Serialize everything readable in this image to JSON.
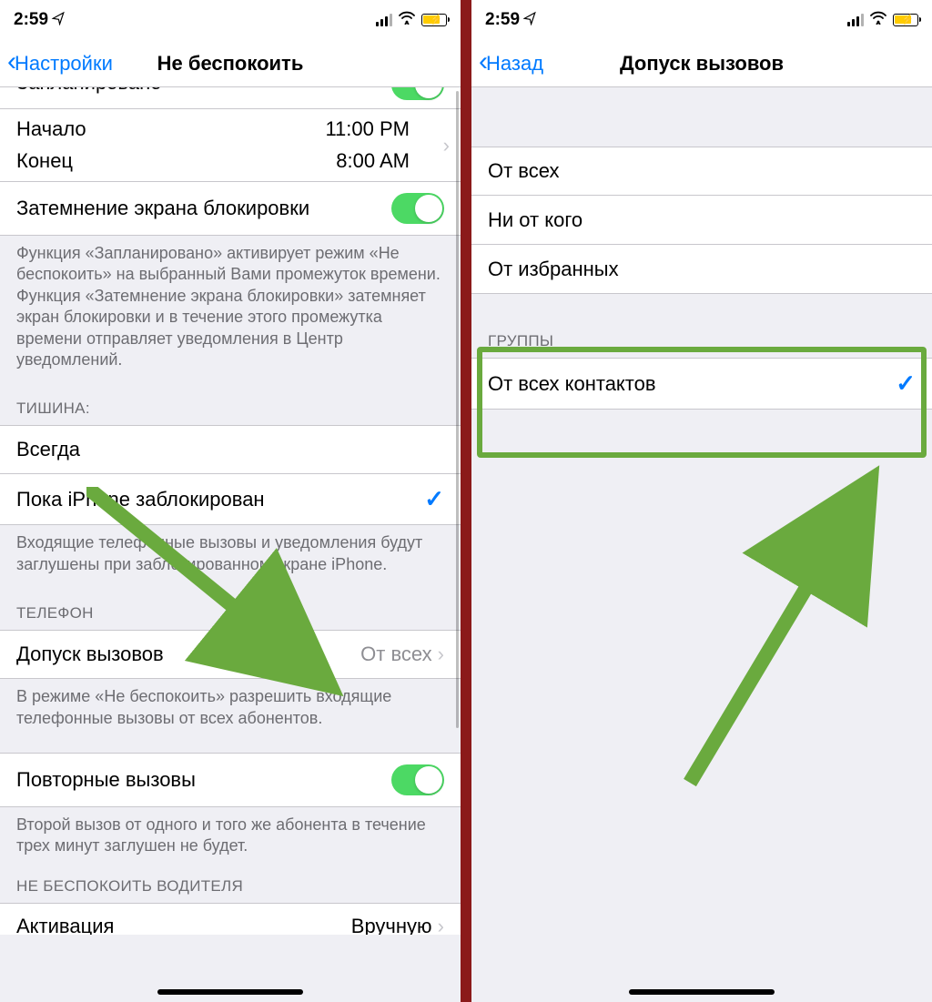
{
  "status": {
    "time": "2:59",
    "location_icon": "✈",
    "signal": "signal-3of4",
    "wifi": "wifi",
    "battery": "charging-yellow"
  },
  "left_screen": {
    "nav": {
      "back": "Настройки",
      "title": "Не беспокоить"
    },
    "scheduled_partial_label": "Запланировано",
    "start": {
      "label": "Начало",
      "value": "11:00 PM"
    },
    "end": {
      "label": "Конец",
      "value": "8:00 AM"
    },
    "dim_lock": {
      "label": "Затемнение экрана блокировки"
    },
    "footer_scheduled": "Функция «Запланировано» активирует режим «Не беспокоить» на выбранный Вами промежуток времени. Функция «Затемнение экрана блокировки» затемняет экран блокировки и в течение этого промежутка времени отправляет уведомления в Центр уведомлений.",
    "silence_header": "ТИШИНА:",
    "silence_always": "Всегда",
    "silence_locked": "Пока iPhone заблокирован",
    "footer_silence": "Входящие телефонные вызовы и уведомления будут заглушены при заблокированном экране iPhone.",
    "phone_header": "ТЕЛЕФОН",
    "allow_calls": {
      "label": "Допуск вызовов",
      "value": "От всех"
    },
    "footer_allow": "В режиме «Не беспокоить» разрешить входящие телефонные вызовы от всех абонентов.",
    "repeated_calls": {
      "label": "Повторные вызовы"
    },
    "footer_repeated": "Второй вызов от одного и того же абонента в течение трех минут заглушен не будет.",
    "driver_header": "НЕ БЕСПОКОИТЬ ВОДИТЕЛЯ",
    "activation": {
      "label": "Активация",
      "value": "Вручную"
    }
  },
  "right_screen": {
    "nav": {
      "back": "Назад",
      "title": "Допуск вызовов"
    },
    "option_everyone": "От всех",
    "option_noone": "Ни от кого",
    "option_favorites": "От избранных",
    "groups_header": "ГРУППЫ",
    "option_all_contacts": "От всех контактов"
  }
}
